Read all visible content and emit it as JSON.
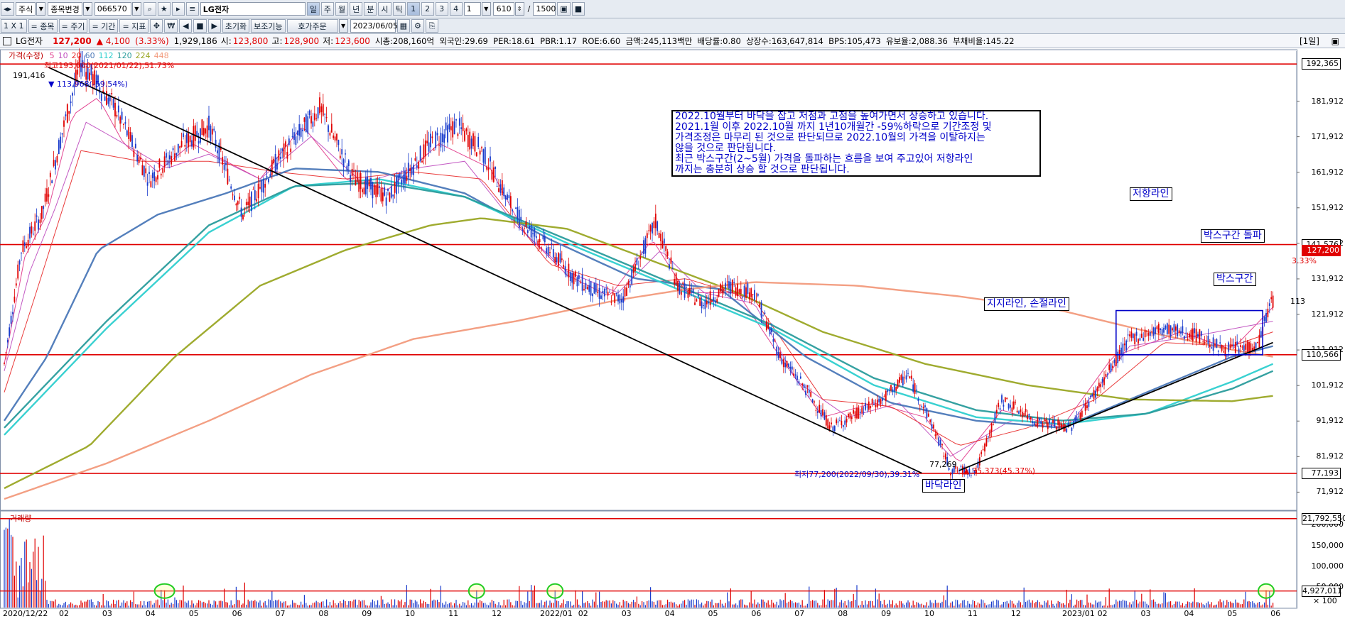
{
  "toolbar": {
    "market": "주식",
    "search_label": "종목변경",
    "code": "066570",
    "name": "LG전자",
    "periods": [
      "일",
      "주",
      "월",
      "년",
      "분",
      "시",
      "틱"
    ],
    "nums": [
      "1",
      "2",
      "3",
      "4"
    ],
    "num_value": "1",
    "count": "610",
    "max": "1500"
  },
  "toolbar2": {
    "grid": "1 X 1",
    "add_item": "= 종목",
    "cycle": "= 주기",
    "range": "= 기간",
    "indicator": "= 지표",
    "reset": "초기화",
    "aux": "보조기능",
    "order": "호가주문",
    "date": "2023/06/05"
  },
  "info": {
    "name": "LG전자",
    "price": "127,200",
    "change": "▲ 4,100",
    "rate": "(3.33%)",
    "volume": "1,929,186",
    "open_label": "시:",
    "open": "123,800",
    "high_label": "고:",
    "high": "128,900",
    "low_label": "저:",
    "low": "123,600",
    "rest": "시총:208,160억  외국인:29.69  PER:18.61  PBR:1.17  ROE:6.60  금액:245,113백만  배당률:0.80  상장수:163,647,814  BPS:105,473  유보율:2,088.36  부채비율:145.22",
    "period": "[1일]"
  },
  "legend": {
    "price": "가격(수정)",
    "mas": [
      {
        "label": "5",
        "color": "#e13c8c"
      },
      {
        "label": "10",
        "color": "#c050c0"
      },
      {
        "label": "20",
        "color": "#e83030"
      },
      {
        "label": "60",
        "color": "#4b78b8"
      },
      {
        "label": "112",
        "color": "#2ecfcf"
      },
      {
        "label": "120",
        "color": "#2a9c9c"
      },
      {
        "label": "224",
        "color": "#9aa624"
      },
      {
        "label": "448",
        "color": "#f29a7c"
      }
    ],
    "high_note": "최고193,000(2021/01/22),51.73%",
    "volume": "거래량"
  },
  "annotations": {
    "comment": [
      "2022.10월부터 바닥을 잡고 저점과 고점을 높여가면서 상승하고 있습니다.",
      "2021.1월 이후 2022.10월 까지 1년10개월간 -59%하락으로 기간조정 및",
      "가격조정은 마무리 된 것으로 판단되므로 2022.10월의 가격을 이탈하지는",
      "않을 것으로 판단됩니다.",
      "최근 박스구간(2~5월) 가격을 돌파하는 흐름을 보여 주고있어 저항라인",
      "까지는 충분히 상승 할 것으로 판단됩니다."
    ],
    "resistance": "저항라인",
    "breakout": "박스구간 돌파",
    "box": "박스구간",
    "support": "지지라인, 손절라인",
    "bottom": "바닥라인",
    "peak": "191,416",
    "peak_drop": "▼ 113,968(-59.54%)",
    "low": "77,269",
    "low_note": "최저77,200(2022/09/30),39.31%",
    "rise": "▲ 35,373(45.37%)",
    "trend_end": "113",
    "cur_rate": "3.33%"
  },
  "chart_data": {
    "type": "candlestick",
    "ylim": [
      67000,
      196000
    ],
    "y_ticks": [
      "181,912",
      "171,912",
      "161,912",
      "151,912",
      "141,912",
      "131,912",
      "121,912",
      "111,912",
      "101,912",
      "91,912",
      "81,912",
      "71,912"
    ],
    "y_tick_values": [
      181912,
      171912,
      161912,
      151912,
      141912,
      131912,
      121912,
      111912,
      101912,
      91912,
      81912,
      71912
    ],
    "horizontal_lines": [
      {
        "value": 192365,
        "label": "192,365"
      },
      {
        "value": 141576,
        "label": "141,576"
      },
      {
        "value": 110566,
        "label": "110,566"
      },
      {
        "value": 77193,
        "label": "77,193"
      }
    ],
    "current_price": {
      "value": 127200,
      "label": "127,200"
    },
    "x_labels": [
      "2020/12/22",
      "02",
      "03",
      "04",
      "05",
      "06",
      "07",
      "08",
      "09",
      "10",
      "11",
      "12",
      "2022/01",
      "02",
      "03",
      "04",
      "05",
      "06",
      "07",
      "08",
      "09",
      "10",
      "11",
      "12",
      "2023/01",
      "02",
      "03",
      "04",
      "05",
      "06"
    ],
    "price_path": [
      [
        0,
        108000
      ],
      [
        10,
        140000
      ],
      [
        22,
        150000
      ],
      [
        35,
        175000
      ],
      [
        45,
        193000
      ],
      [
        65,
        180000
      ],
      [
        85,
        160000
      ],
      [
        105,
        170000
      ],
      [
        120,
        175000
      ],
      [
        140,
        150000
      ],
      [
        160,
        165000
      ],
      [
        185,
        180000
      ],
      [
        205,
        160000
      ],
      [
        225,
        155000
      ],
      [
        250,
        170000
      ],
      [
        265,
        175000
      ],
      [
        280,
        168000
      ],
      [
        300,
        150000
      ],
      [
        320,
        140000
      ],
      [
        335,
        132000
      ],
      [
        348,
        128000
      ],
      [
        362,
        126000
      ],
      [
        382,
        148000
      ],
      [
        395,
        130000
      ],
      [
        410,
        125000
      ],
      [
        425,
        130000
      ],
      [
        440,
        128000
      ],
      [
        455,
        110000
      ],
      [
        470,
        101000
      ],
      [
        485,
        90000
      ],
      [
        500,
        94000
      ],
      [
        515,
        98000
      ],
      [
        530,
        105000
      ],
      [
        545,
        90000
      ],
      [
        555,
        78000
      ],
      [
        570,
        78000
      ],
      [
        585,
        98000
      ],
      [
        605,
        92000
      ],
      [
        625,
        90000
      ],
      [
        640,
        100000
      ],
      [
        660,
        115000
      ],
      [
        680,
        118000
      ],
      [
        700,
        116000
      ],
      [
        715,
        112000
      ],
      [
        735,
        113000
      ],
      [
        744,
        127200
      ]
    ],
    "ma_paths": [
      {
        "name": "5",
        "color": "#e13c8c",
        "points": [
          [
            0,
            108000
          ],
          [
            12,
            138000
          ],
          [
            25,
            150000
          ],
          [
            40,
            178000
          ],
          [
            55,
            183000
          ],
          [
            70,
            170000
          ],
          [
            90,
            162000
          ],
          [
            110,
            170000
          ],
          [
            130,
            165000
          ],
          [
            150,
            160000
          ],
          [
            175,
            175000
          ],
          [
            200,
            160000
          ],
          [
            225,
            157000
          ],
          [
            255,
            170000
          ],
          [
            285,
            163000
          ],
          [
            305,
            145000
          ],
          [
            330,
            133000
          ],
          [
            355,
            127000
          ],
          [
            380,
            143000
          ],
          [
            400,
            128000
          ],
          [
            430,
            128000
          ],
          [
            455,
            110000
          ],
          [
            480,
            93000
          ],
          [
            510,
            97000
          ],
          [
            540,
            93000
          ],
          [
            560,
            80000
          ],
          [
            585,
            95000
          ],
          [
            620,
            90000
          ],
          [
            650,
            110000
          ],
          [
            690,
            117000
          ],
          [
            720,
            112000
          ],
          [
            744,
            124000
          ]
        ]
      },
      {
        "name": "10",
        "color": "#c050c0",
        "points": [
          [
            0,
            106000
          ],
          [
            15,
            134000
          ],
          [
            30,
            152000
          ],
          [
            48,
            176000
          ],
          [
            70,
            170000
          ],
          [
            95,
            163000
          ],
          [
            120,
            167000
          ],
          [
            150,
            160000
          ],
          [
            180,
            172000
          ],
          [
            210,
            159000
          ],
          [
            240,
            163000
          ],
          [
            270,
            165000
          ],
          [
            300,
            147000
          ],
          [
            330,
            134000
          ],
          [
            360,
            128000
          ],
          [
            385,
            140000
          ],
          [
            410,
            128000
          ],
          [
            440,
            125000
          ],
          [
            465,
            103000
          ],
          [
            495,
            93000
          ],
          [
            525,
            97000
          ],
          [
            555,
            82000
          ],
          [
            590,
            92000
          ],
          [
            625,
            91000
          ],
          [
            660,
            113000
          ],
          [
            700,
            116000
          ],
          [
            744,
            120000
          ]
        ]
      },
      {
        "name": "20",
        "color": "#e83030",
        "points": [
          [
            0,
            100000
          ],
          [
            20,
            130000
          ],
          [
            45,
            168000
          ],
          [
            80,
            165000
          ],
          [
            120,
            165000
          ],
          [
            160,
            162000
          ],
          [
            200,
            160000
          ],
          [
            240,
            162000
          ],
          [
            280,
            160000
          ],
          [
            320,
            136000
          ],
          [
            360,
            130000
          ],
          [
            400,
            132000
          ],
          [
            440,
            126000
          ],
          [
            480,
            98000
          ],
          [
            520,
            96000
          ],
          [
            560,
            85000
          ],
          [
            600,
            90000
          ],
          [
            640,
            98000
          ],
          [
            680,
            114000
          ],
          [
            720,
            113000
          ],
          [
            744,
            117000
          ]
        ]
      },
      {
        "name": "60",
        "color": "#4b78b8",
        "points": [
          [
            0,
            92000
          ],
          [
            25,
            110000
          ],
          [
            55,
            140000
          ],
          [
            90,
            150000
          ],
          [
            130,
            156000
          ],
          [
            170,
            163000
          ],
          [
            220,
            162000
          ],
          [
            270,
            156000
          ],
          [
            320,
            143000
          ],
          [
            370,
            132000
          ],
          [
            420,
            129000
          ],
          [
            470,
            110000
          ],
          [
            520,
            97000
          ],
          [
            570,
            92000
          ],
          [
            620,
            90000
          ],
          [
            670,
            100000
          ],
          [
            720,
            110000
          ],
          [
            744,
            113000
          ]
        ]
      },
      {
        "name": "112",
        "color": "#2ecfcf",
        "points": [
          [
            0,
            88000
          ],
          [
            60,
            118000
          ],
          [
            120,
            145000
          ],
          [
            170,
            158000
          ],
          [
            220,
            160000
          ],
          [
            270,
            155000
          ],
          [
            330,
            142000
          ],
          [
            390,
            130000
          ],
          [
            450,
            118000
          ],
          [
            510,
            102000
          ],
          [
            570,
            93000
          ],
          [
            620,
            91000
          ],
          [
            670,
            94000
          ],
          [
            720,
            103000
          ],
          [
            744,
            108000
          ]
        ]
      },
      {
        "name": "120",
        "color": "#2a9c9c",
        "points": [
          [
            0,
            90000
          ],
          [
            60,
            120000
          ],
          [
            120,
            147000
          ],
          [
            170,
            158000
          ],
          [
            220,
            159000
          ],
          [
            270,
            155000
          ],
          [
            330,
            143000
          ],
          [
            390,
            131000
          ],
          [
            450,
            119000
          ],
          [
            510,
            104000
          ],
          [
            570,
            95000
          ],
          [
            620,
            92000
          ],
          [
            670,
            94000
          ],
          [
            720,
            101000
          ],
          [
            744,
            106000
          ]
        ]
      },
      {
        "name": "224",
        "color": "#9aa624",
        "points": [
          [
            0,
            73000
          ],
          [
            50,
            85000
          ],
          [
            100,
            110000
          ],
          [
            150,
            130000
          ],
          [
            200,
            140000
          ],
          [
            250,
            147000
          ],
          [
            280,
            149000
          ],
          [
            330,
            146000
          ],
          [
            380,
            137000
          ],
          [
            430,
            128000
          ],
          [
            480,
            117000
          ],
          [
            540,
            108000
          ],
          [
            600,
            102000
          ],
          [
            660,
            98000
          ],
          [
            720,
            97500
          ],
          [
            744,
            99000
          ]
        ]
      },
      {
        "name": "448",
        "color": "#f29a7c",
        "points": [
          [
            0,
            70000
          ],
          [
            60,
            80000
          ],
          [
            120,
            92000
          ],
          [
            180,
            105000
          ],
          [
            240,
            115000
          ],
          [
            300,
            120000
          ],
          [
            360,
            126000
          ],
          [
            400,
            129000
          ],
          [
            440,
            131000
          ],
          [
            500,
            130000
          ],
          [
            560,
            127000
          ],
          [
            620,
            123000
          ],
          [
            680,
            116000
          ],
          [
            720,
            112000
          ],
          [
            744,
            110000
          ]
        ]
      }
    ],
    "trendlines": [
      {
        "from": [
          26,
          191416
        ],
        "to": [
          538,
          77269
        ]
      },
      {
        "from": [
          560,
          78000
        ],
        "to": [
          744,
          114000
        ]
      }
    ],
    "box_zone": {
      "from": 652,
      "to": 738,
      "low": 110566,
      "high": 123000
    },
    "volume": {
      "ylim": [
        0,
        230000
      ],
      "y_ticks": [
        "200,000",
        "150,000",
        "100,000",
        "50,000"
      ],
      "y_tick_values": [
        200000,
        150000,
        100000,
        50000
      ],
      "lines": [
        {
          "value": 215000,
          "label": "21,792,550"
        },
        {
          "value": 40000,
          "label": "4,927,011"
        }
      ],
      "unit": "× 100",
      "highlight_bars": [
        94,
        277,
        323,
        740
      ]
    }
  }
}
